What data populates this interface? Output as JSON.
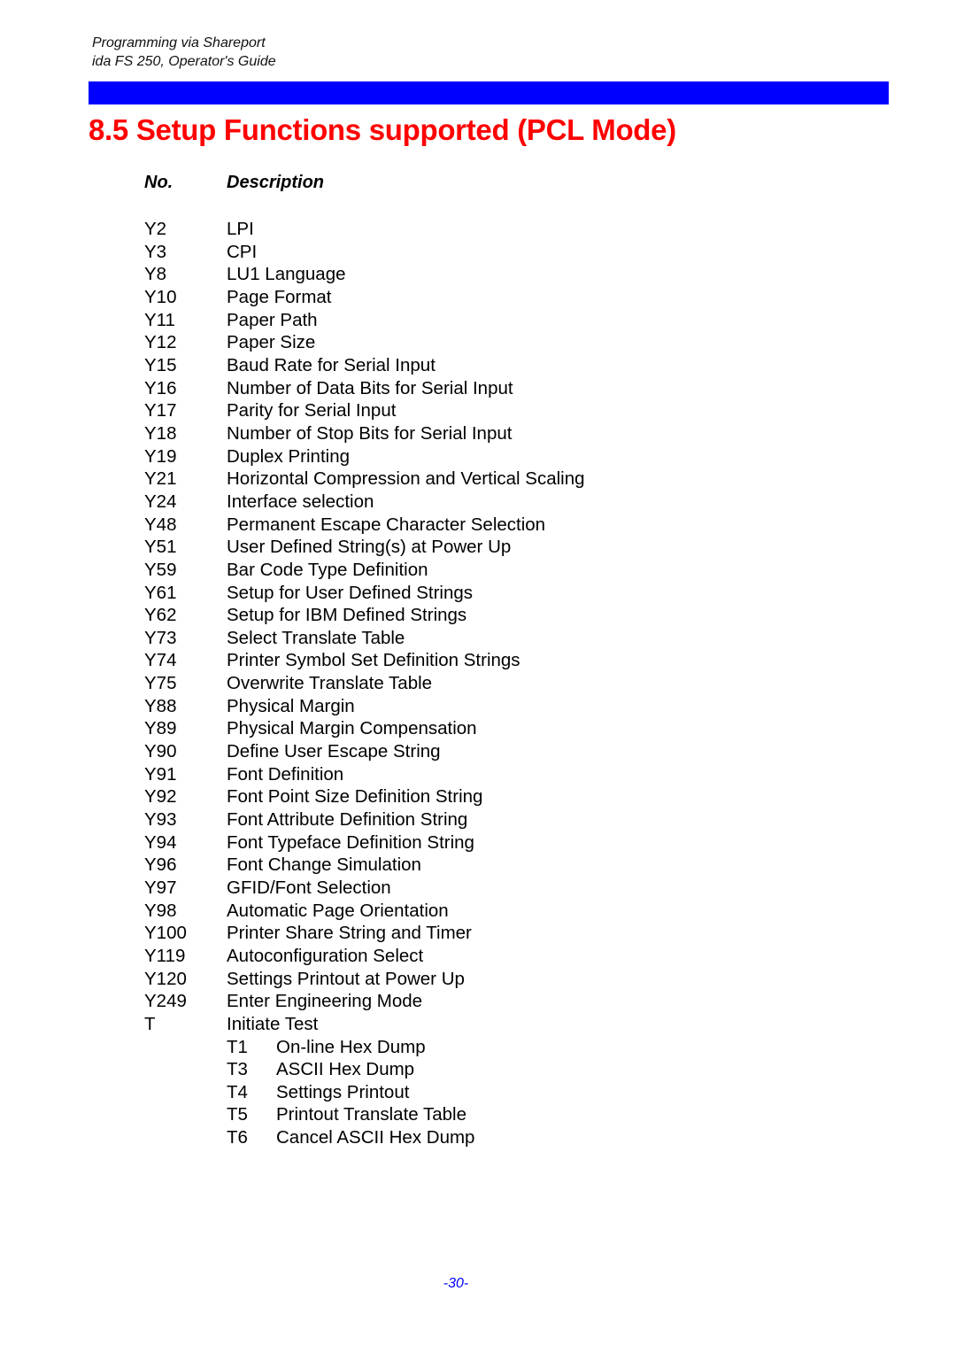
{
  "header": {
    "line1": "Programming via Shareport",
    "line2": "ida FS 250, Operator's Guide"
  },
  "colors": {
    "bar": "#0000ff",
    "title": "#ff0000",
    "page_number": "#0000ff"
  },
  "title": "8.5 Setup Functions supported (PCL Mode)",
  "table": {
    "headers": {
      "no": "No.",
      "description": "Description"
    },
    "rows": [
      {
        "no": "Y2",
        "description": "LPI"
      },
      {
        "no": "Y3",
        "description": "CPI"
      },
      {
        "no": "Y8",
        "description": "LU1 Language"
      },
      {
        "no": "Y10",
        "description": "Page Format"
      },
      {
        "no": "Y11",
        "description": "Paper Path"
      },
      {
        "no": "Y12",
        "description": "Paper Size"
      },
      {
        "no": "Y15",
        "description": "Baud Rate for Serial Input"
      },
      {
        "no": "Y16",
        "description": "Number of Data Bits for Serial Input"
      },
      {
        "no": "Y17",
        "description": "Parity for Serial Input"
      },
      {
        "no": "Y18",
        "description": "Number of Stop Bits for Serial Input"
      },
      {
        "no": "Y19",
        "description": "Duplex Printing"
      },
      {
        "no": "Y21",
        "description": "Horizontal Compression  and Vertical Scaling"
      },
      {
        "no": "Y24",
        "description": "Interface selection"
      },
      {
        "no": "Y48",
        "description": "Permanent Escape Character Selection"
      },
      {
        "no": "Y51",
        "description": "User Defined String(s) at Power Up"
      },
      {
        "no": "Y59",
        "description": "Bar Code Type Definition"
      },
      {
        "no": "Y61",
        "description": "Setup for User Defined Strings"
      },
      {
        "no": "Y62",
        "description": "Setup for IBM Defined Strings"
      },
      {
        "no": "Y73",
        "description": "Select Translate Table"
      },
      {
        "no": "Y74",
        "description": "Printer Symbol Set Definition Strings"
      },
      {
        "no": "Y75",
        "description": "Overwrite Translate Table"
      },
      {
        "no": "Y88",
        "description": "Physical Margin"
      },
      {
        "no": "Y89",
        "description": "Physical Margin Compensation"
      },
      {
        "no": "Y90",
        "description": "Define User Escape String"
      },
      {
        "no": "Y91",
        "description": "Font Definition"
      },
      {
        "no": "Y92",
        "description": "Font Point Size Definition String"
      },
      {
        "no": "Y93",
        "description": "Font Attribute Definition String"
      },
      {
        "no": "Y94",
        "description": "Font Typeface Definition String"
      },
      {
        "no": "Y96",
        "description": "Font Change Simulation"
      },
      {
        "no": "Y97",
        "description": "GFID/Font Selection"
      },
      {
        "no": "Y98",
        "description": "Automatic Page Orientation"
      },
      {
        "no": "Y100",
        "description": "Printer Share String and Timer"
      },
      {
        "no": "Y119",
        "description": "Autoconfiguration Select"
      },
      {
        "no": "Y120",
        "description": "Settings Printout at Power Up"
      },
      {
        "no": "Y249",
        "description": "Enter Engineering Mode"
      },
      {
        "no": "T",
        "description": "Initiate Test"
      }
    ],
    "sub_rows": [
      {
        "no": "T1",
        "description": "On-line Hex Dump"
      },
      {
        "no": "T3",
        "description": "ASCII Hex Dump"
      },
      {
        "no": "T4",
        "description": "Settings Printout"
      },
      {
        "no": "T5",
        "description": "Printout Translate Table"
      },
      {
        "no": "T6",
        "description": "Cancel ASCII Hex Dump"
      }
    ]
  },
  "page_number": "-30-"
}
